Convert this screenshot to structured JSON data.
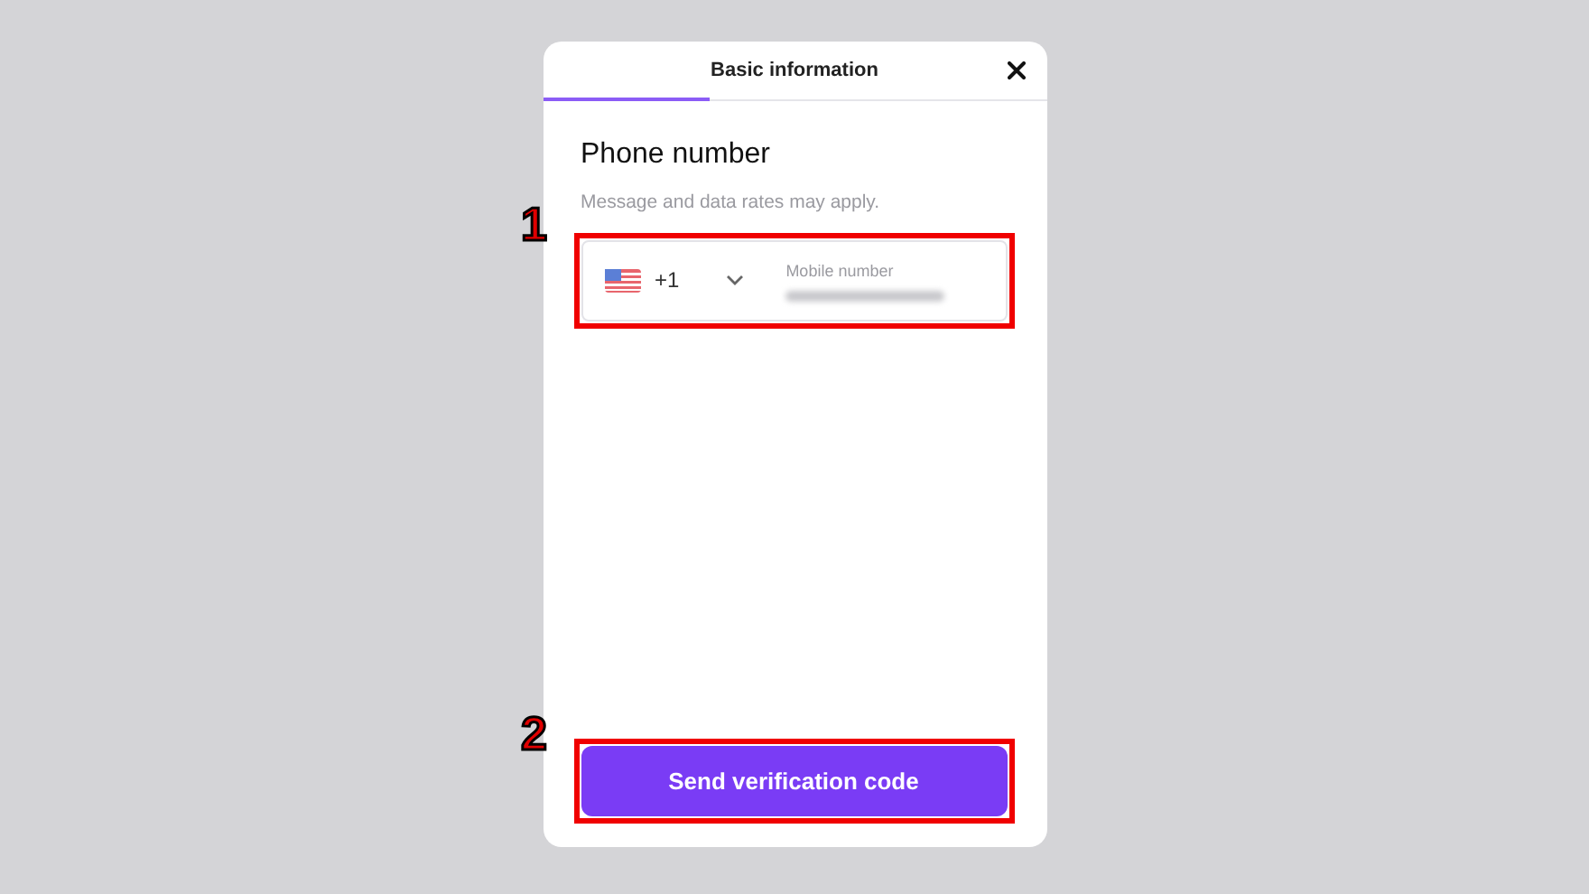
{
  "header": {
    "title": "Basic information",
    "progress": {
      "level": 0.33
    }
  },
  "section": {
    "title": "Phone number",
    "note": "Message and data rates may apply."
  },
  "phone_field": {
    "country_code": "+1",
    "label": "Mobile number"
  },
  "button": {
    "label": "Send verification code"
  },
  "annotations": [
    {
      "label": "1",
      "kind": "field"
    },
    {
      "label": "2",
      "kind": "button"
    }
  ]
}
